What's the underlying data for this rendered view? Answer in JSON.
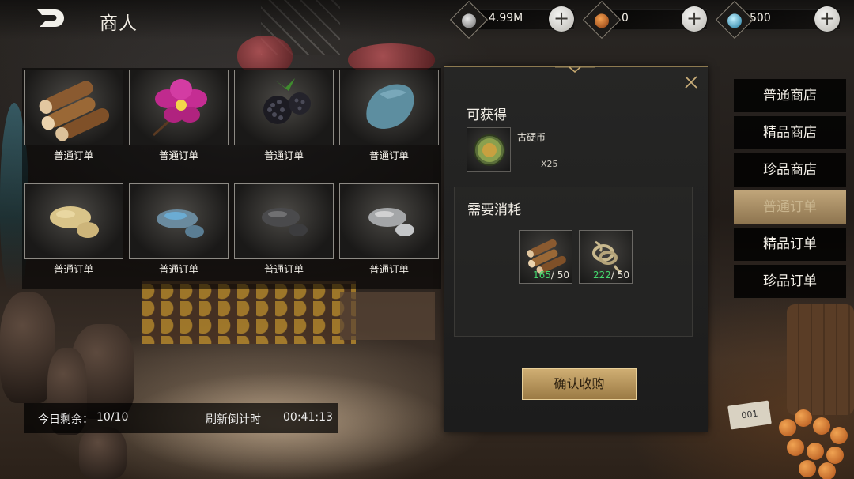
{
  "header": {
    "title": "商人",
    "currencies": [
      {
        "icon": "silver-coin-icon",
        "value": "4.99M"
      },
      {
        "icon": "bronze-medal-icon",
        "value": "0"
      },
      {
        "icon": "blue-gem-icon",
        "value": "500"
      }
    ],
    "add_label": "+"
  },
  "items": [
    {
      "icon": "wood-logs-icon",
      "label": "普通订单"
    },
    {
      "icon": "orchid-flower-icon",
      "label": "普通订单"
    },
    {
      "icon": "blackberry-icon",
      "label": "普通订单"
    },
    {
      "icon": "blue-stone-icon",
      "label": "普通订单"
    },
    {
      "icon": "yellow-ore-icon",
      "label": "普通订单"
    },
    {
      "icon": "blue-ore-icon",
      "label": "普通订单"
    },
    {
      "icon": "dark-ore-icon",
      "label": "普通订单"
    },
    {
      "icon": "white-ore-icon",
      "label": "普通订单"
    }
  ],
  "status": {
    "remaining_label": "今日剩余：",
    "remaining_value": "10/10",
    "refresh_label": "刷新倒计时",
    "refresh_value": "00:41:13"
  },
  "panel": {
    "obtain_title": "可获得",
    "reward": {
      "icon": "ancient-coin-icon",
      "name": "古硬币",
      "qty": "X25"
    },
    "cost_title": "需要消耗",
    "costs": [
      {
        "icon": "wood-logs-icon",
        "have": "165",
        "need": "/ 50"
      },
      {
        "icon": "rope-bundle-icon",
        "have": "222",
        "need": "/ 50"
      }
    ],
    "confirm_label": "确认收购"
  },
  "tabs": [
    {
      "label": "普通商店",
      "active": false
    },
    {
      "label": "精品商店",
      "active": false
    },
    {
      "label": "珍品商店",
      "active": false
    },
    {
      "label": "普通订单",
      "active": true
    },
    {
      "label": "精品订单",
      "active": false
    },
    {
      "label": "珍品订单",
      "active": false
    }
  ],
  "colors": {
    "accent_gold": "#cfae73",
    "have_green": "#44d66c",
    "active_tab": "#c0a57a"
  }
}
